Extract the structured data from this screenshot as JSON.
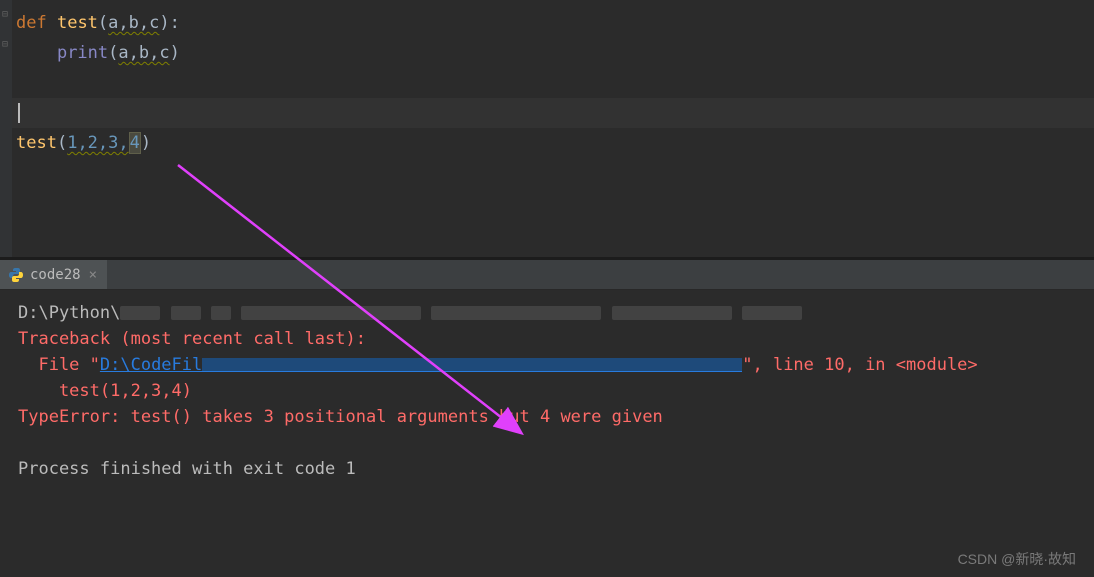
{
  "editor": {
    "line1": {
      "keyword": "def",
      "func": "test",
      "open": "(",
      "params": "a,b,c",
      "close": "):"
    },
    "line2": {
      "indent": "    ",
      "builtin": "print",
      "open": "(",
      "params": "a,b,c",
      "close": ")"
    },
    "line5": {
      "func": "test",
      "open": "(",
      "args": "1,2,3,",
      "lastarg": "4",
      "close": ")"
    }
  },
  "tab": {
    "label": "code28"
  },
  "console": {
    "cmd_prefix": "D:\\Python\\",
    "traceback": "Traceback (most recent call last):",
    "file_prefix": "  File \"",
    "file_link": "D:\\CodeFil",
    "file_suffix": "\", line 10, in <module>",
    "call_line": "    test(1,2,3,4)",
    "error": "TypeError: test() takes 3 positional arguments but 4 were given",
    "exit": "Process finished with exit code 1"
  },
  "watermark": "CSDN @新晓·故知"
}
